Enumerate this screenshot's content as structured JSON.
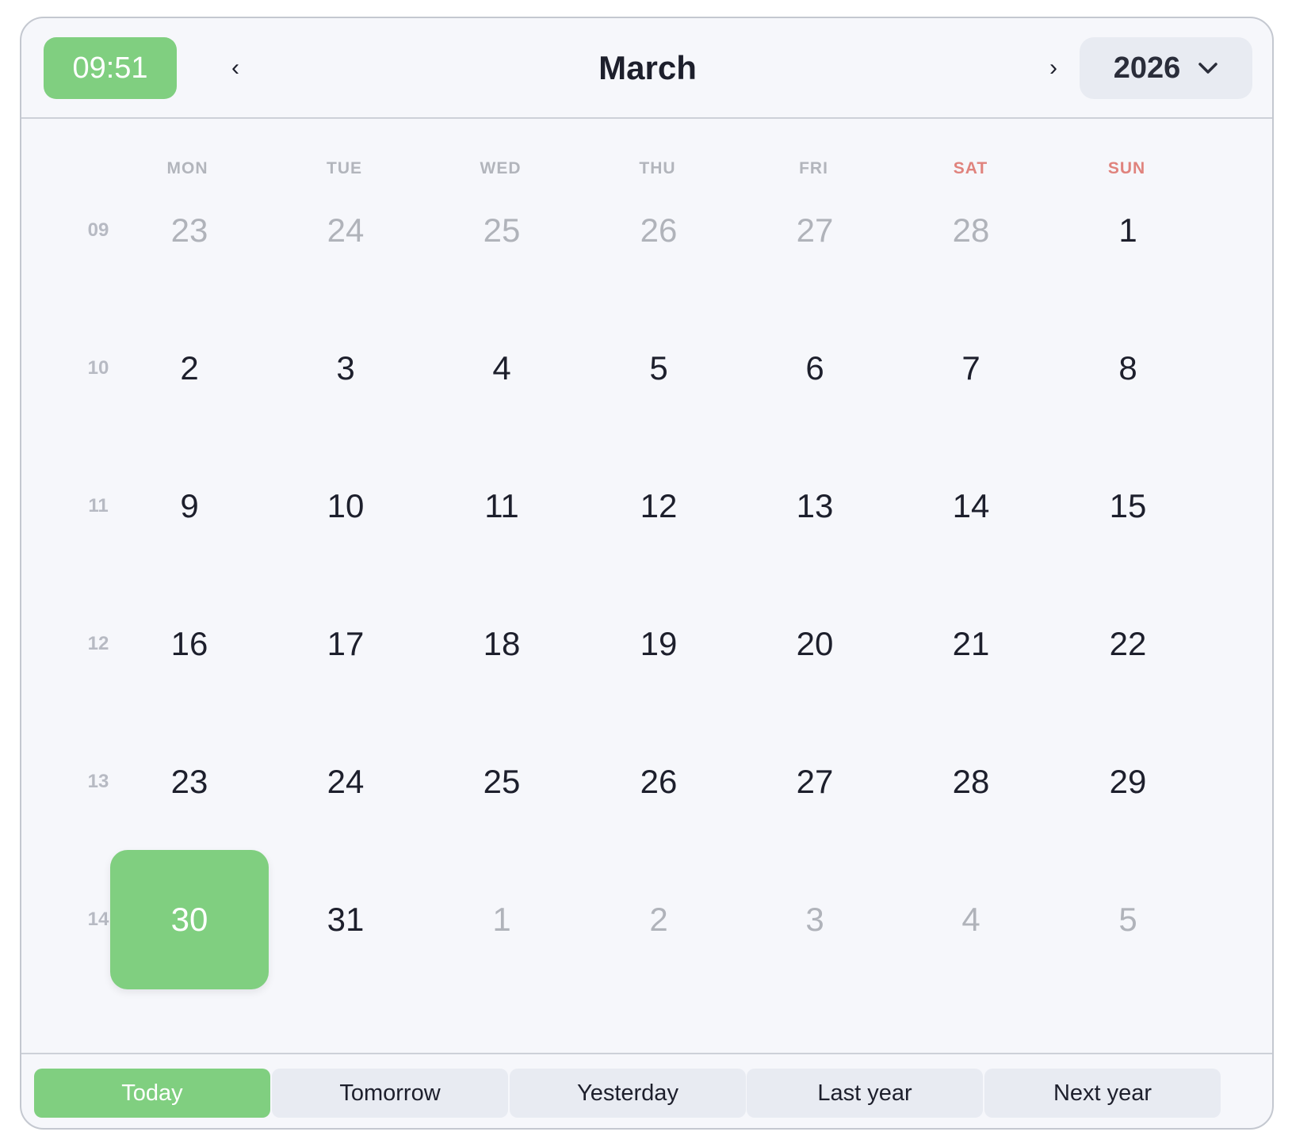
{
  "header": {
    "time": "09:51",
    "prev_label": "‹",
    "next_label": "›",
    "month": "March",
    "year": "2026",
    "accent_color": "#80cf80"
  },
  "weekdays": [
    "MON",
    "TUE",
    "WED",
    "THU",
    "FRI",
    "SAT",
    "SUN"
  ],
  "weeks": [
    {
      "num": "09",
      "days": [
        {
          "d": "23",
          "muted": true
        },
        {
          "d": "24",
          "muted": true
        },
        {
          "d": "25",
          "muted": true
        },
        {
          "d": "26",
          "muted": true
        },
        {
          "d": "27",
          "muted": true
        },
        {
          "d": "28",
          "muted": true
        },
        {
          "d": "1",
          "muted": false
        }
      ]
    },
    {
      "num": "10",
      "days": [
        {
          "d": "2"
        },
        {
          "d": "3"
        },
        {
          "d": "4"
        },
        {
          "d": "5"
        },
        {
          "d": "6"
        },
        {
          "d": "7"
        },
        {
          "d": "8"
        }
      ]
    },
    {
      "num": "11",
      "days": [
        {
          "d": "9"
        },
        {
          "d": "10"
        },
        {
          "d": "11"
        },
        {
          "d": "12"
        },
        {
          "d": "13"
        },
        {
          "d": "14"
        },
        {
          "d": "15"
        }
      ]
    },
    {
      "num": "12",
      "days": [
        {
          "d": "16"
        },
        {
          "d": "17"
        },
        {
          "d": "18"
        },
        {
          "d": "19"
        },
        {
          "d": "20"
        },
        {
          "d": "21"
        },
        {
          "d": "22"
        }
      ]
    },
    {
      "num": "13",
      "days": [
        {
          "d": "23"
        },
        {
          "d": "24"
        },
        {
          "d": "25"
        },
        {
          "d": "26"
        },
        {
          "d": "27"
        },
        {
          "d": "28"
        },
        {
          "d": "29"
        }
      ]
    },
    {
      "num": "14",
      "days": [
        {
          "d": "30",
          "today": true
        },
        {
          "d": "31"
        },
        {
          "d": "1",
          "muted": true
        },
        {
          "d": "2",
          "muted": true
        },
        {
          "d": "3",
          "muted": true
        },
        {
          "d": "4",
          "muted": true
        },
        {
          "d": "5",
          "muted": true
        }
      ]
    }
  ],
  "shortcuts": [
    {
      "label": "Today",
      "active": true
    },
    {
      "label": "Tomorrow",
      "active": false
    },
    {
      "label": "Yesterday",
      "active": false
    },
    {
      "label": "Last year",
      "active": false
    },
    {
      "label": "Next year",
      "active": false
    }
  ]
}
